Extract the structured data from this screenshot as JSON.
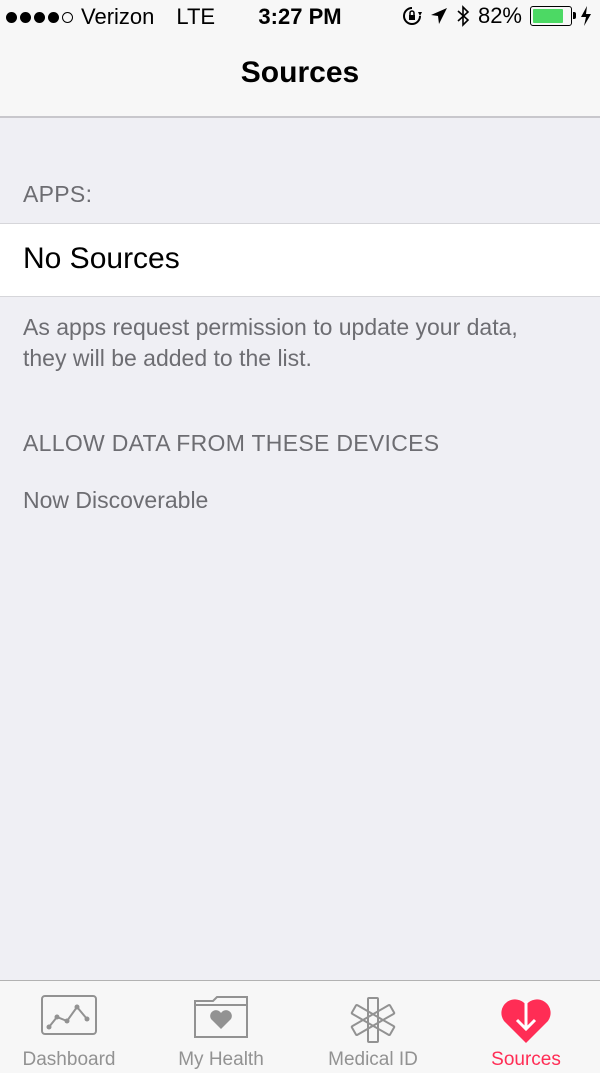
{
  "status_bar": {
    "carrier": "Verizon",
    "network": "LTE",
    "time": "3:27 PM",
    "battery_percent": "82%",
    "battery_level": 0.82,
    "signal_bars": 4,
    "signal_max": 5
  },
  "nav": {
    "title": "Sources"
  },
  "apps_section": {
    "header": "APPS:",
    "row_label": "No Sources",
    "footer": "As apps request permission to update your data, they will be added to the list."
  },
  "devices_section": {
    "header": "ALLOW DATA FROM THESE DEVICES",
    "status": "Now Discoverable"
  },
  "tabs": [
    {
      "label": "Dashboard",
      "icon": "dashboard-chart-icon"
    },
    {
      "label": "My Health",
      "icon": "folder-heart-icon"
    },
    {
      "label": "Medical ID",
      "icon": "medical-star-icon"
    },
    {
      "label": "Sources",
      "icon": "heart-arrow-icon",
      "active": true
    }
  ],
  "colors": {
    "accent": "#ff2d55",
    "battery": "#4cd964",
    "background": "#efeff4"
  }
}
